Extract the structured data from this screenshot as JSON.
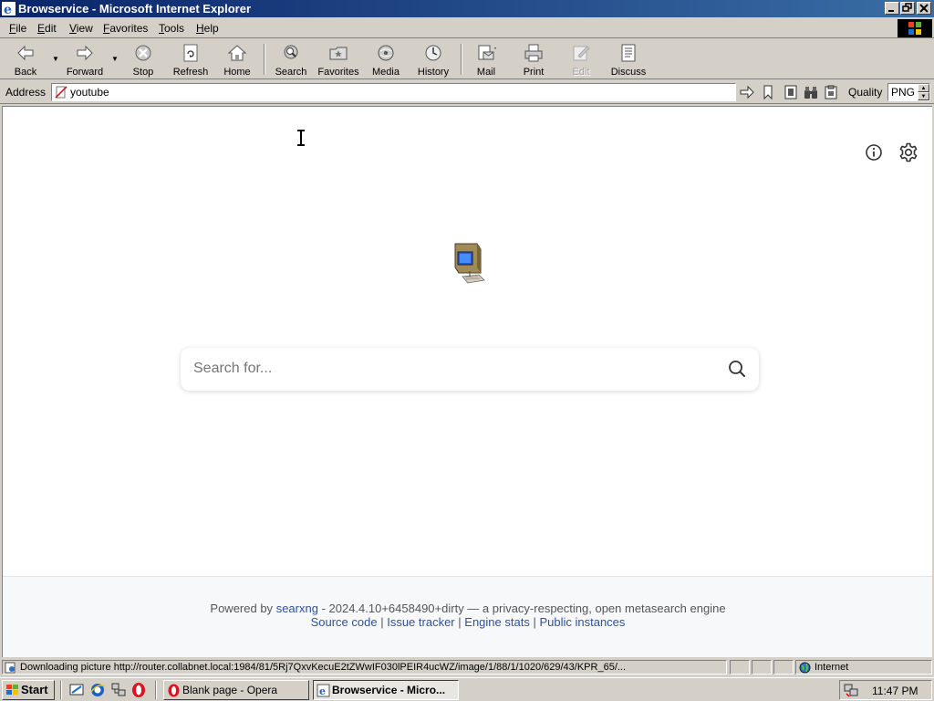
{
  "window": {
    "title": "Browservice - Microsoft Internet Explorer"
  },
  "menu": [
    "File",
    "Edit",
    "View",
    "Favorites",
    "Tools",
    "Help"
  ],
  "toolbar": {
    "back": "Back",
    "forward": "Forward",
    "stop": "Stop",
    "refresh": "Refresh",
    "home": "Home",
    "search": "Search",
    "favorites": "Favorites",
    "media": "Media",
    "history": "History",
    "mail": "Mail",
    "print": "Print",
    "edit": "Edit",
    "discuss": "Discuss"
  },
  "address": {
    "label": "Address",
    "value": "youtube",
    "quality_label": "Quality",
    "quality_value": "PNG"
  },
  "page": {
    "search_placeholder": "Search for...",
    "footer": {
      "powered_by": "Powered by",
      "engine_name": "searxng",
      "version_text": "- 2024.4.10+6458490+dirty — a privacy-respecting, open metasearch engine",
      "links": [
        "Source code",
        "Issue tracker",
        "Engine stats",
        "Public instances"
      ],
      "separator": "|"
    }
  },
  "statusbar": {
    "text": "Downloading picture http://router.collabnet.local:1984/81/5Rj7QxvKecuE2tZWwIF030lPEIR4ucWZ/image/1/88/1/1020/629/43/KPR_65/...",
    "zone": "Internet"
  },
  "taskbar": {
    "start": "Start",
    "tasks": [
      "Blank page - Opera",
      "Browservice - Micro..."
    ],
    "clock": "11:47 PM"
  },
  "colors": {
    "titlebar_start": "#0a246a",
    "titlebar_end": "#3a6ea5",
    "chrome": "#d4d0c8",
    "link": "#3050a0"
  }
}
